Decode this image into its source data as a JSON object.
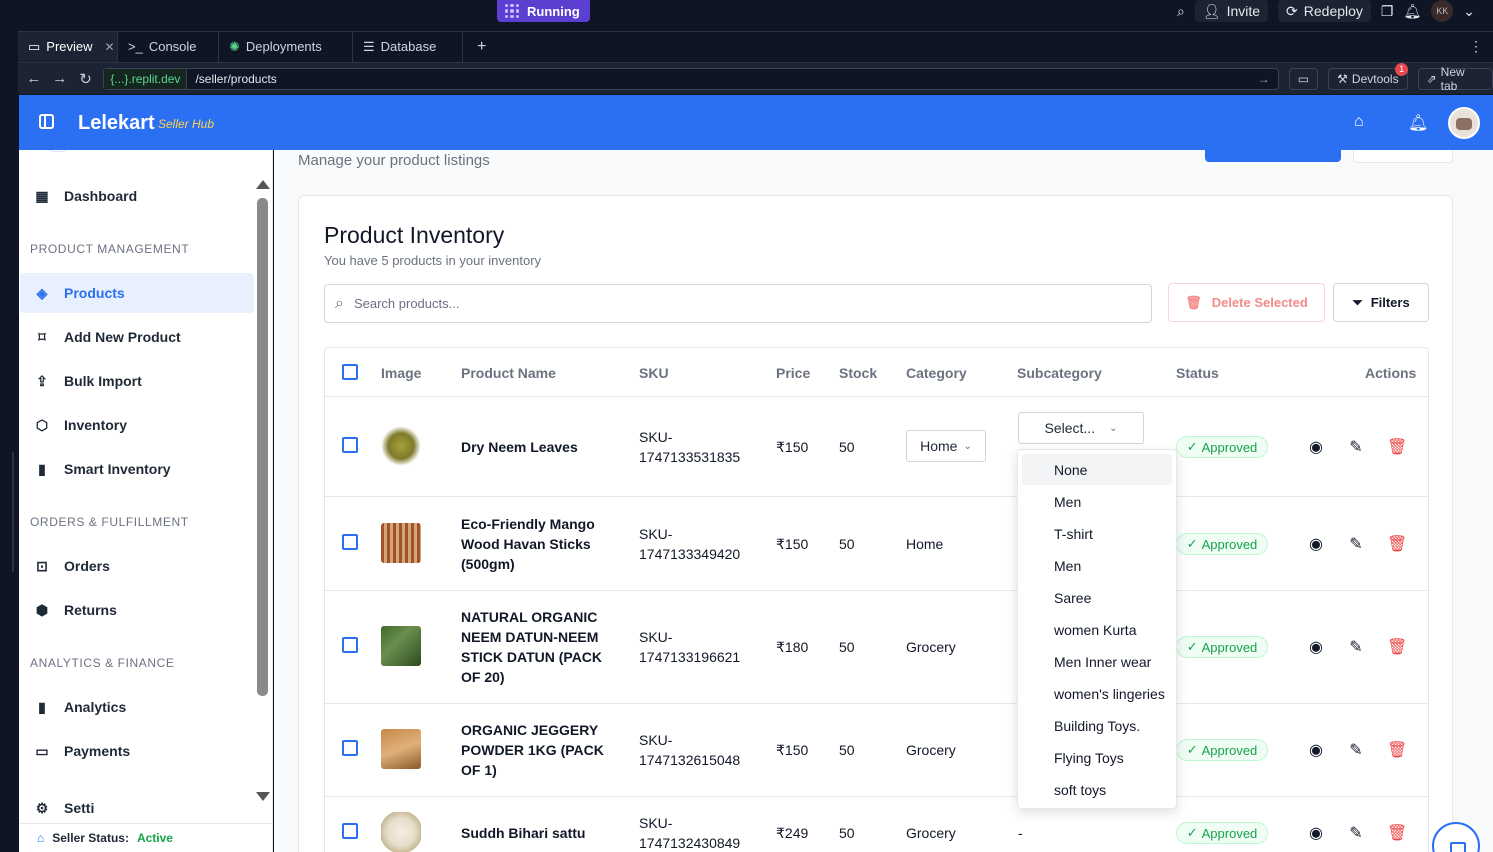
{
  "replit": {
    "run_status": "Running",
    "invite_label": "Invite",
    "redeploy_label": "Redeploy",
    "user_initials": "KK",
    "tabs": [
      {
        "label": "Preview"
      },
      {
        "label": "Console"
      },
      {
        "label": "Deployments"
      },
      {
        "label": "Database"
      }
    ],
    "url_domain": "{...}.replit.dev",
    "url_path": "/seller/products",
    "devtools_label": "Devtools",
    "devtools_badge": "1",
    "newtab_label": "New tab"
  },
  "app": {
    "brand": "Lelekart",
    "brand_sub": "Seller Hub"
  },
  "sidebar": {
    "dashboard": "Dashboard",
    "section_product": "PRODUCT MANAGEMENT",
    "products": "Products",
    "add_new": "Add New Product",
    "bulk_import": "Bulk Import",
    "inventory": "Inventory",
    "smart_inventory": "Smart Inventory",
    "section_orders": "ORDERS & FULFILLMENT",
    "orders": "Orders",
    "returns": "Returns",
    "section_analytics": "ANALYTICS & FINANCE",
    "analytics": "Analytics",
    "payments": "Payments",
    "settings_partial": "Setti",
    "status_label": "Seller Status:",
    "status_value": "Active"
  },
  "main": {
    "page_subtitle": "Manage your product listings",
    "card_title": "Product Inventory",
    "card_subtitle": "You have 5 products in your inventory",
    "search_placeholder": "Search products...",
    "delete_selected": "Delete Selected",
    "filters": "Filters"
  },
  "table": {
    "headers": {
      "image": "Image",
      "name": "Product Name",
      "sku": "SKU",
      "price": "Price",
      "stock": "Stock",
      "category": "Category",
      "subcategory": "Subcategory",
      "status": "Status",
      "actions": "Actions"
    },
    "rows": [
      {
        "name_lines": [
          "Dry Neem Leaves"
        ],
        "sku1": "SKU-",
        "sku2": "1747133531835",
        "price": "₹150",
        "stock": "50",
        "category": "Home",
        "subcategory": "Select...",
        "status": "Approved"
      },
      {
        "name_lines": [
          "Eco-Friendly Mango",
          "Wood Havan Sticks",
          "(500gm)"
        ],
        "sku1": "SKU-",
        "sku2": "1747133349420",
        "price": "₹150",
        "stock": "50",
        "category": "Home",
        "subcategory": "",
        "status": "Approved"
      },
      {
        "name_lines": [
          "NATURAL ORGANIC",
          "NEEM DATUN-NEEM",
          "STICK DATUN (PACK",
          "OF 20)"
        ],
        "sku1": "SKU-",
        "sku2": "1747133196621",
        "price": "₹180",
        "stock": "50",
        "category": "Grocery",
        "subcategory": "",
        "status": "Approved"
      },
      {
        "name_lines": [
          "ORGANIC JEGGERY",
          "POWDER 1KG (PACK",
          "OF 1)"
        ],
        "sku1": "SKU-",
        "sku2": "1747132615048",
        "price": "₹150",
        "stock": "50",
        "category": "Grocery",
        "subcategory": "",
        "status": "Approved"
      },
      {
        "name_lines": [
          "Suddh Bihari sattu"
        ],
        "sku1": "SKU-",
        "sku2": "1747132430849",
        "price": "₹249",
        "stock": "50",
        "category": "Grocery",
        "subcategory": "-",
        "status": "Approved"
      }
    ]
  },
  "subcategory_dropdown": {
    "options": [
      "None",
      "Men",
      "T-shirt",
      "Men",
      "Saree",
      "women Kurta",
      "Men Inner wear",
      "women's lingeries",
      "Building Toys.",
      "Flying Toys",
      "soft toys"
    ]
  },
  "colors": {
    "brand_blue": "#2b6ff2",
    "brand_sub_yellow": "#ffd34d",
    "approved_green": "#16a34a",
    "delete_red": "#ef4444"
  }
}
